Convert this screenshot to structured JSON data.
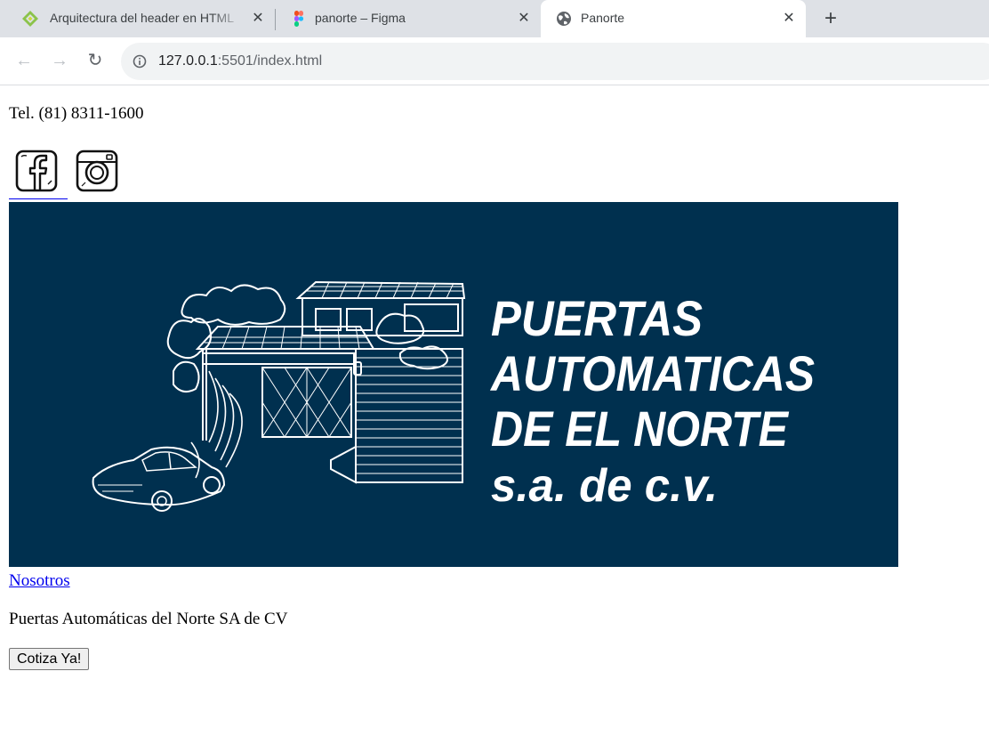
{
  "browser": {
    "tabs": [
      {
        "title": "Arquitectura del header en HTML",
        "icon": "green-diamond-icon"
      },
      {
        "title": "panorte – Figma",
        "icon": "figma-icon"
      },
      {
        "title": "Panorte",
        "icon": "globe-icon",
        "active": true
      }
    ],
    "close_glyph": "✕",
    "new_tab_glyph": "+",
    "nav": {
      "back": "←",
      "forward": "→",
      "reload": "↻"
    },
    "address": {
      "host": "127.0.0.1",
      "rest": ":5501/index.html"
    }
  },
  "page": {
    "phone": "Tel. (81) 8311-1600",
    "social": [
      {
        "name": "facebook",
        "icon": "facebook-icon"
      },
      {
        "name": "instagram",
        "icon": "instagram-icon"
      }
    ],
    "banner": {
      "lines": [
        "PUERTAS",
        "AUTOMATICAS",
        "DE EL NORTE",
        "s.a. de c.v."
      ],
      "background": "#00304f",
      "foreground": "#ffffff"
    },
    "nav_link": "Nosotros",
    "tagline": "Puertas Automáticas del Norte SA de CV",
    "cta": "Cotiza Ya!"
  }
}
